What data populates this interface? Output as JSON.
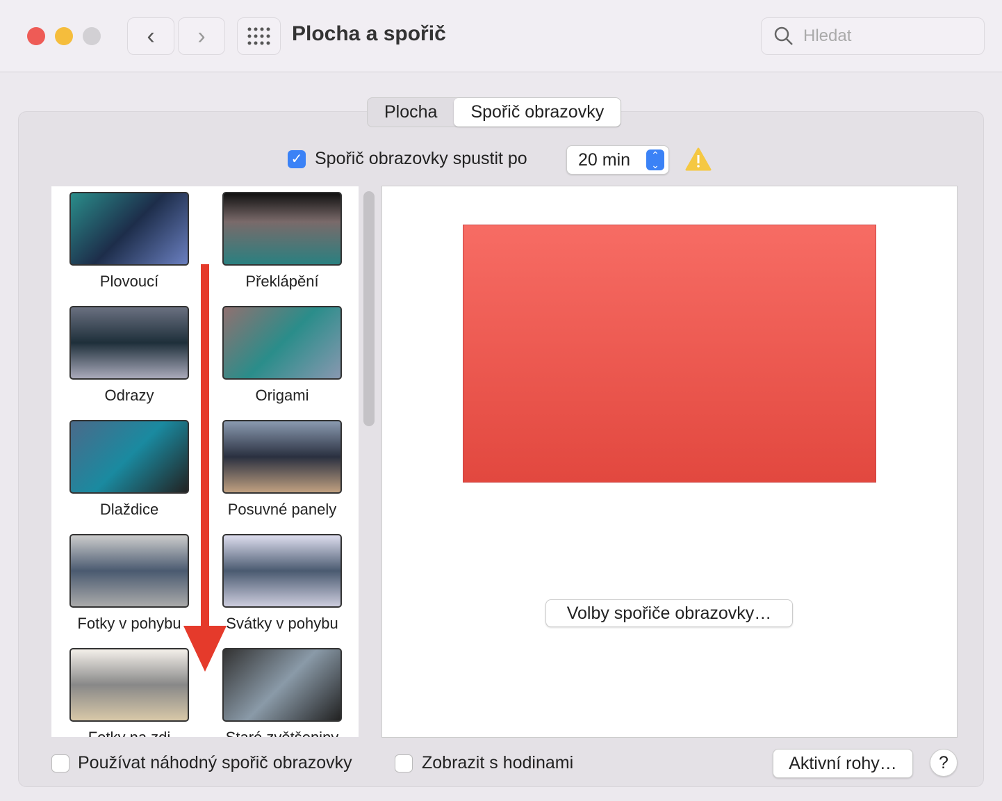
{
  "window": {
    "title": "Plocha a spořič",
    "search_placeholder": "Hledat"
  },
  "tabs": [
    {
      "label": "Plocha",
      "active": false
    },
    {
      "label": "Spořič obrazovky",
      "active": true
    }
  ],
  "start_after": {
    "label": "Spořič obrazovky spustit po",
    "checked": true,
    "value": "20 min"
  },
  "savers": [
    "Plovoucí",
    "Překlápění",
    "Odrazy",
    "Origami",
    "Dlaždice",
    "Posuvné panely",
    "Fotky v pohybu",
    "Svátky v pohybu",
    "Fotky na zdi",
    "Staré zvětšeniny"
  ],
  "options_button": "Volby spořiče obrazovky…",
  "random_saver": {
    "label": "Používat náhodný spořič obrazovky",
    "checked": false
  },
  "show_clock": {
    "label": "Zobrazit s hodinami",
    "checked": false
  },
  "hot_corners_button": "Aktivní rohy…",
  "help_button": "?",
  "colors": {
    "accent": "#3b82f6",
    "preview": "#e8544c",
    "arrow": "#e53a2b"
  }
}
